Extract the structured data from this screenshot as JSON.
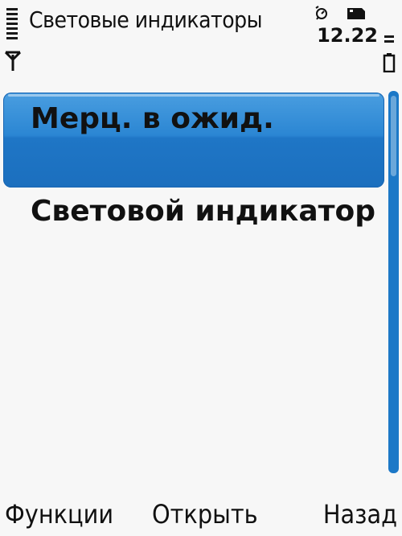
{
  "status_bar": {
    "title": "Световые индикаторы",
    "time": "12.22",
    "signal_icon": "antenna-icon",
    "alarm_icon": "alarm-clock-icon",
    "sim_icon": "sim-card-icon",
    "battery_icon": "battery-icon"
  },
  "list": {
    "items": [
      {
        "label": "Мерц. в ожид.",
        "selected": true
      },
      {
        "label": "Световой индикатор",
        "selected": false
      }
    ]
  },
  "softkeys": {
    "left": "Функции",
    "middle": "Открыть",
    "right": "Назад"
  },
  "colors": {
    "accent": "#1f76c6",
    "background": "#f7f7f7",
    "text": "#111111"
  }
}
